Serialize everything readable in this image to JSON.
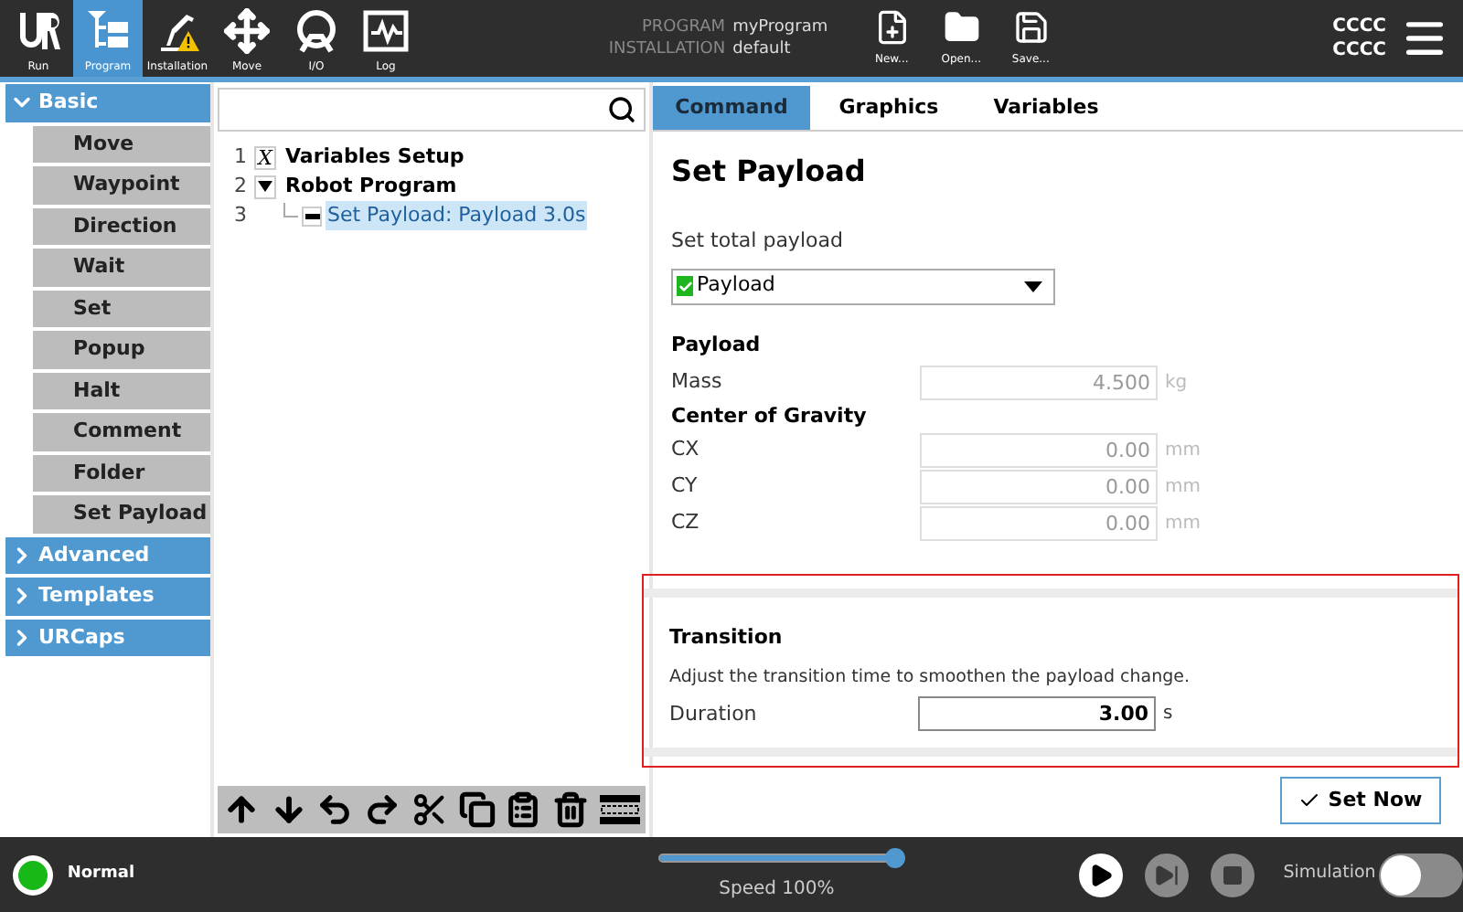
{
  "top_bar": {
    "nav": [
      {
        "kind": "run",
        "label": "Run",
        "selected": false
      },
      {
        "kind": "program",
        "label": "Program",
        "selected": true
      },
      {
        "kind": "installation",
        "label": "Installation",
        "selected": false
      },
      {
        "kind": "move",
        "label": "Move",
        "selected": false
      },
      {
        "kind": "io",
        "label": "I/O",
        "selected": false
      },
      {
        "kind": "log",
        "label": "Log",
        "selected": false
      }
    ],
    "info": [
      {
        "label": "PROGRAM",
        "value": "myProgram"
      },
      {
        "label": "INSTALLATION",
        "value": "default"
      }
    ],
    "file_buttons": [
      {
        "kind": "new",
        "label": "New..."
      },
      {
        "kind": "open",
        "label": "Open..."
      },
      {
        "kind": "save",
        "label": "Save..."
      }
    ],
    "status_codes": [
      "CCCC",
      "CCCC"
    ]
  },
  "sidebar": {
    "groups": [
      {
        "label": "Basic",
        "expanded": true,
        "items": [
          {
            "label": "Move"
          },
          {
            "label": "Waypoint"
          },
          {
            "label": "Direction"
          },
          {
            "label": "Wait"
          },
          {
            "label": "Set"
          },
          {
            "label": "Popup"
          },
          {
            "label": "Halt"
          },
          {
            "label": "Comment"
          },
          {
            "label": "Folder"
          },
          {
            "label": "Set Payload"
          }
        ]
      },
      {
        "label": "Advanced",
        "expanded": false
      },
      {
        "label": "Templates",
        "expanded": false
      },
      {
        "label": "URCaps",
        "expanded": false
      }
    ]
  },
  "program_tree": {
    "rows": [
      {
        "number": "1",
        "kind": "variables",
        "icon": "X",
        "label": "Variables Setup",
        "selected": false
      },
      {
        "number": "2",
        "kind": "folder",
        "expanded": true,
        "label": "Robot Program",
        "selected": false,
        "children": [
          {
            "number": "3",
            "kind": "node",
            "label": "Set Payload: Payload 3.0s",
            "selected": true
          }
        ]
      }
    ],
    "toolbar": [
      {
        "kind": "up"
      },
      {
        "kind": "down"
      },
      {
        "kind": "undo"
      },
      {
        "kind": "redo"
      },
      {
        "kind": "cut"
      },
      {
        "kind": "copy"
      },
      {
        "kind": "paste"
      },
      {
        "kind": "delete"
      },
      {
        "kind": "suppress"
      }
    ]
  },
  "tabs": [
    {
      "label": "Command",
      "selected": true
    },
    {
      "label": "Graphics",
      "selected": false
    },
    {
      "label": "Variables",
      "selected": false
    }
  ],
  "command": {
    "title": "Set Payload",
    "dropdown_label": "Set total payload",
    "dropdown": {
      "value": "Payload",
      "valid": true
    },
    "payload_heading": "Payload",
    "mass": {
      "label": "Mass",
      "value": "4.500",
      "unit": "kg",
      "disabled": true
    },
    "cog_heading": "Center of Gravity",
    "cog": [
      {
        "label": "CX",
        "value": "0.00",
        "unit": "mm",
        "disabled": true
      },
      {
        "label": "CY",
        "value": "0.00",
        "unit": "mm",
        "disabled": true
      },
      {
        "label": "CZ",
        "value": "0.00",
        "unit": "mm",
        "disabled": true
      }
    ],
    "transition": {
      "heading": "Transition",
      "description": "Adjust the transition time to smoothen the payload change.",
      "duration": {
        "label": "Duration",
        "value": "3.00",
        "unit": "s",
        "disabled": false
      }
    },
    "set_now_button": "Set Now"
  },
  "bottom_bar": {
    "status": {
      "label": "Normal",
      "color": "#18b818"
    },
    "speed": {
      "label": "Speed 100%",
      "level": 1.0
    },
    "controls": [
      {
        "kind": "play",
        "disabled": false
      },
      {
        "kind": "step",
        "disabled": true
      },
      {
        "kind": "stop",
        "disabled": true
      }
    ],
    "simulation": {
      "label": "Simulation",
      "on": false
    }
  }
}
